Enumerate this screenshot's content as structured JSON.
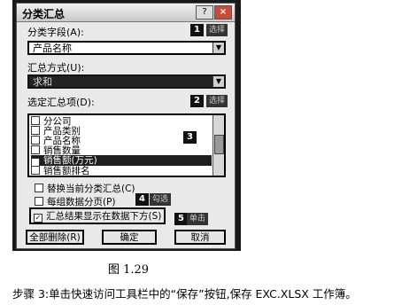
{
  "dialog": {
    "title": "分类汇总",
    "help_glyph": "?",
    "close_glyph": "×"
  },
  "group_field": {
    "label": "分类字段(A):",
    "value": "产品名称",
    "badge_number": "1",
    "badge_text": "选择"
  },
  "summary_method": {
    "label": "汇总方式(U):",
    "value": "求和"
  },
  "summary_items": {
    "label": "选定汇总项(D):",
    "badge_number": "2",
    "badge_text": "选择",
    "items": [
      {
        "label": "分公司",
        "checked": false
      },
      {
        "label": "产品类别",
        "checked": false
      },
      {
        "label": "产品名称",
        "checked": false
      },
      {
        "label": "销售数量",
        "checked": false
      },
      {
        "label": "销售额(万元)",
        "checked": true
      },
      {
        "label": "销售额排名",
        "checked": false
      }
    ],
    "badge3": "3"
  },
  "options": {
    "replace_label": "替换当前分类汇总(C)",
    "page_break_label": "每组数据分页(P)",
    "below_label": "汇总结果显示在数据下方(S)",
    "badge4_number": "4",
    "badge4_text": "勾选"
  },
  "buttons": {
    "remove_all": "全部删除(R)",
    "ok": "确定",
    "cancel": "取消",
    "badge5_number": "5",
    "badge5_text": "单击"
  },
  "caption": "图 1.29",
  "step_text": "步骤 3:单击快速访问工具栏中的“保存”按钮,保存 EXC.XLSX 工作簿。",
  "colors": {
    "background": "#e9e9e9",
    "highlight": "#1e1e1e",
    "badge": "#111111"
  }
}
